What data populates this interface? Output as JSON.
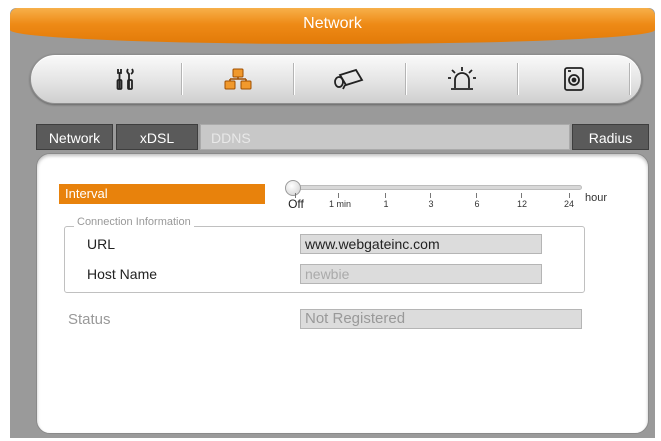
{
  "window": {
    "title": "Network"
  },
  "toolbar": {
    "icons": [
      {
        "name": "tools-icon"
      },
      {
        "name": "network-icon"
      },
      {
        "name": "camera-icon"
      },
      {
        "name": "alarm-icon"
      },
      {
        "name": "disk-icon"
      }
    ]
  },
  "tabs": {
    "network": "Network",
    "xdsl": "xDSL",
    "ddns": "DDNS",
    "radius": "Radius"
  },
  "ddns": {
    "interval_label": "Interval",
    "interval_value": "Off",
    "interval_ticks": [
      "Off",
      "1 min",
      "1",
      "3",
      "6",
      "12",
      "24"
    ],
    "interval_unit": "hour",
    "group_legend": "Connection Information",
    "url_label": "URL",
    "url_value": "www.webgateinc.com",
    "host_label": "Host Name",
    "host_value": "newbie",
    "status_label": "Status",
    "status_value": "Not Registered"
  },
  "colors": {
    "accent": "#e8820c",
    "title_bar": "#ee8a16",
    "frame": "#9a9a9a",
    "tab_dark": "#5a5a5a"
  }
}
